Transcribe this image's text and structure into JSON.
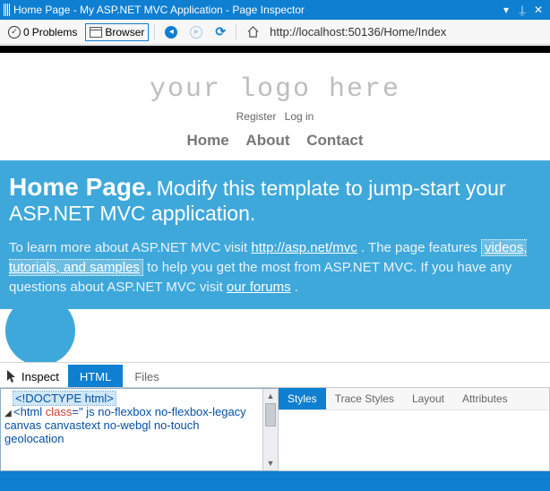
{
  "titlebar": {
    "title": "Home Page - My ASP.NET MVC Application - Page Inspector"
  },
  "toolbar": {
    "problems_count": "0",
    "problems_label": "Problems",
    "browser_label": "Browser",
    "url": "http://localhost:50136/Home/Index"
  },
  "page": {
    "logo": "your logo here",
    "register": "Register",
    "login": "Log in",
    "menu": {
      "home": "Home",
      "about": "About",
      "contact": "Contact"
    },
    "hero_title": "Home Page.",
    "hero_sub": "Modify this template to jump-start your ASP.NET MVC application.",
    "body_pre": "To learn more about ASP.NET MVC visit ",
    "body_link1": "http://asp.net/mvc",
    "body_mid1": " . The page features ",
    "body_hl": "videos, tutorials, and samples",
    "body_mid2": " to help you get the most from ASP.NET MVC. If you have any questions about ASP.NET MVC visit ",
    "body_link2": "our forums",
    "body_end": " ."
  },
  "lower_tabs": {
    "inspect": "Inspect",
    "html": "HTML",
    "files": "Files"
  },
  "source": {
    "line1": "<!DOCTYPE html>",
    "line2a": "<html ",
    "line2b": "class",
    "line2c": "=\" js no-flexbox no-flexbox-legacy canvas canvastext no-webgl no-touch geolocation"
  },
  "props_tabs": {
    "styles": "Styles",
    "trace": "Trace Styles",
    "layout": "Layout",
    "attributes": "Attributes"
  }
}
